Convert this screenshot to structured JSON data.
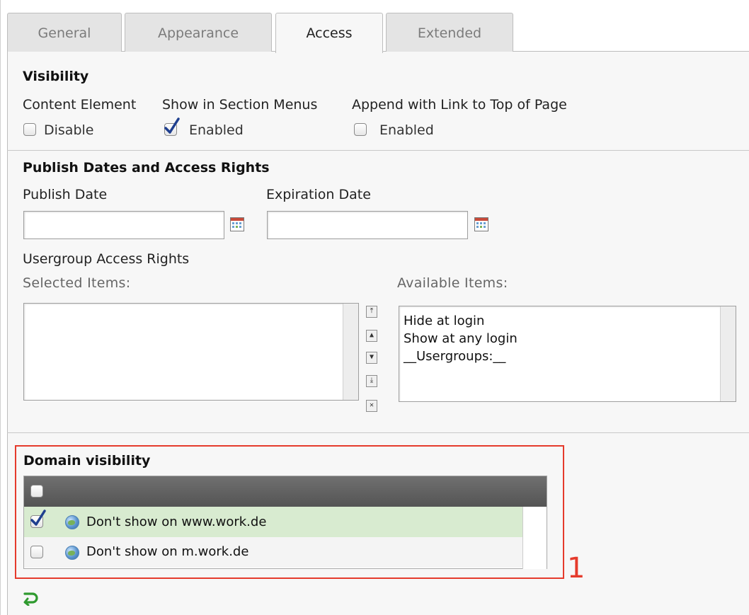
{
  "tabs": [
    {
      "label": "General",
      "active": false
    },
    {
      "label": "Appearance",
      "active": false
    },
    {
      "label": "Access",
      "active": true
    },
    {
      "label": "Extended",
      "active": false
    }
  ],
  "visibility": {
    "heading": "Visibility",
    "content_element_label": "Content Element",
    "content_element_checkbox": "Disable",
    "content_element_checked": false,
    "section_menus_label": "Show in Section Menus",
    "section_menus_checkbox": "Enabled",
    "section_menus_checked": true,
    "link_top_label": "Append with Link to Top of Page",
    "link_top_checkbox": "Enabled",
    "link_top_checked": false
  },
  "publish": {
    "heading": "Publish Dates and Access Rights",
    "publish_date_label": "Publish Date",
    "publish_date_value": "",
    "expiration_date_label": "Expiration Date",
    "expiration_date_value": "",
    "usergroup_label": "Usergroup Access Rights",
    "selected_items_label": "Selected Items:",
    "available_items_label": "Available Items:",
    "selected_items": [],
    "available_items": [
      "Hide at login",
      "Show at any login",
      "__Usergroups:__"
    ]
  },
  "domain": {
    "heading": "Domain visibility",
    "rows": [
      {
        "label": "Don't show on www.work.de",
        "checked": true
      },
      {
        "label": "Don't show on m.work.de",
        "checked": false
      }
    ],
    "annotation": "1"
  },
  "colors": {
    "highlight": "#e53b2c",
    "selected_row": "#d8ebd0",
    "header_bar": "#5e5e5e"
  }
}
